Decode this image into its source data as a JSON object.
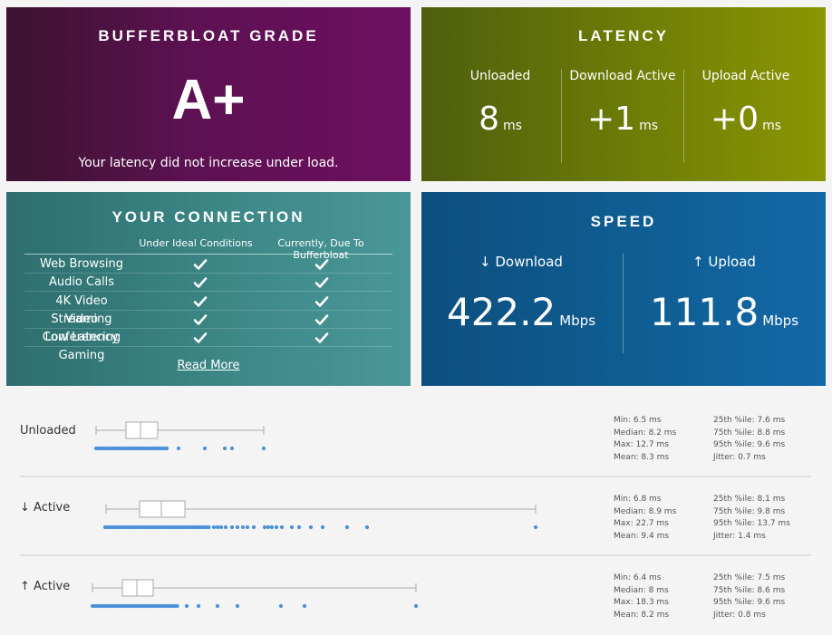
{
  "grade": {
    "title": "BUFFERBLOAT GRADE",
    "value": "A+",
    "description": "Your latency did not increase under load."
  },
  "latency": {
    "title": "LATENCY",
    "columns": [
      {
        "label": "Unloaded",
        "value": "8",
        "unit": "ms"
      },
      {
        "label": "Download Active",
        "value": "+1",
        "unit": "ms"
      },
      {
        "label": "Upload Active",
        "value": "+0",
        "unit": "ms"
      }
    ]
  },
  "connection": {
    "title": "YOUR CONNECTION",
    "headers": [
      "Under Ideal Conditions",
      "Currently, Due To Bufferbloat"
    ],
    "rows": [
      "Web Browsing",
      "Audio Calls",
      "4K Video Streaming",
      "Video Conferencing",
      "Low Latency Gaming"
    ],
    "read_more": "Read More"
  },
  "speed": {
    "title": "SPEED",
    "download": {
      "label": "↓ Download",
      "value": "422.2",
      "unit": "Mbps"
    },
    "upload": {
      "label": "↑ Upload",
      "value": "111.8",
      "unit": "Mbps"
    }
  },
  "colors": {
    "box": "#aaaaaa",
    "dots": "#4a90d9"
  },
  "sections": [
    {
      "label": "Unloaded",
      "left_stats": [
        "Min: 6.5 ms",
        "Median: 8.2 ms",
        "Max: 12.7 ms",
        "Mean: 8.3 ms"
      ],
      "right_stats": [
        "25th %ile: 7.6 ms",
        "75th %ile: 8.8 ms",
        "95th %ile: 9.6 ms",
        "Jitter: 0.7 ms"
      ]
    },
    {
      "label": "↓ Active",
      "left_stats": [
        "Min: 6.8 ms",
        "Median: 8.9 ms",
        "Max: 22.7 ms",
        "Mean: 9.4 ms"
      ],
      "right_stats": [
        "25th %ile: 8.1 ms",
        "75th %ile: 9.8 ms",
        "95th %ile: 13.7 ms",
        "Jitter: 1.4 ms"
      ]
    },
    {
      "label": "↑ Active",
      "left_stats": [
        "Min: 6.4 ms",
        "Median: 8 ms",
        "Max: 18.3 ms",
        "Mean: 8.2 ms"
      ],
      "right_stats": [
        "25th %ile: 7.5 ms",
        "75th %ile: 8.6 ms",
        "95th %ile: 9.6 ms",
        "Jitter: 0.8 ms"
      ]
    }
  ]
}
